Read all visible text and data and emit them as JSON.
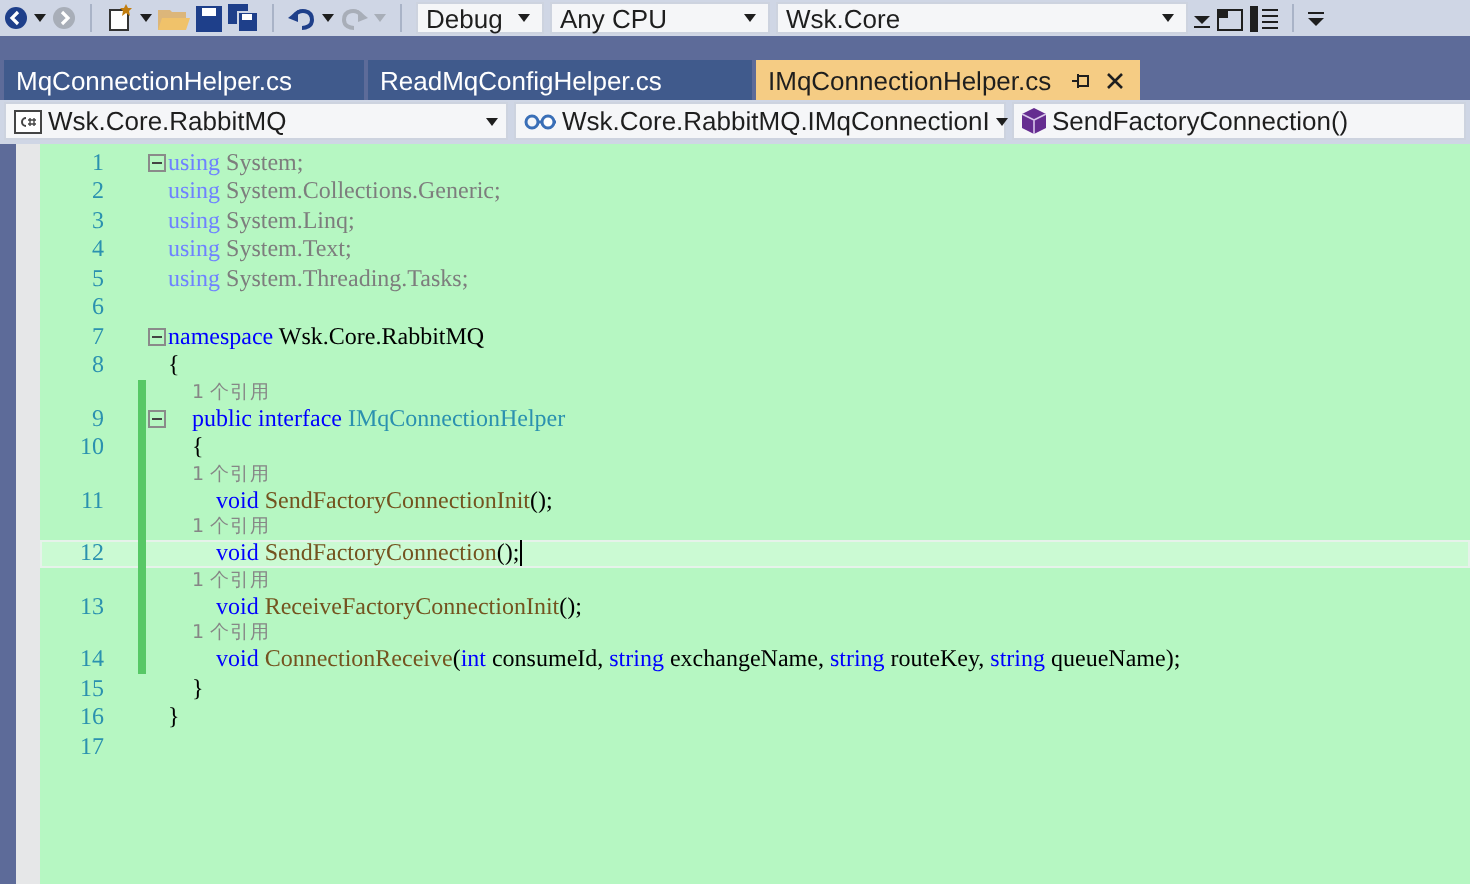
{
  "toolbar": {
    "configuration": "Debug",
    "platform": "Any CPU",
    "startup_project": "Wsk.Core"
  },
  "tabs": [
    {
      "label": "MqConnectionHelper.cs",
      "selected": false
    },
    {
      "label": "ReadMqConfigHelper.cs",
      "selected": false
    },
    {
      "label": "IMqConnectionHelper.cs",
      "selected": true
    }
  ],
  "nav_bar": {
    "project": "Wsk.Core.RabbitMQ",
    "type": "Wsk.Core.RabbitMQ.IMqConnectionI",
    "member": "SendFactoryConnection()"
  },
  "lines": [
    {
      "kind": "code",
      "number": "1",
      "faded": true,
      "expanded": true,
      "tokens": [
        {
          "text": "using",
          "kind": "kw"
        },
        {
          "text": " System;",
          "kind": "plain"
        }
      ]
    },
    {
      "kind": "code",
      "number": "2",
      "faded": true,
      "tokens": [
        {
          "text": "using",
          "kind": "kw"
        },
        {
          "text": " System.Collections.Generic;",
          "kind": "plain"
        }
      ]
    },
    {
      "kind": "code",
      "number": "3",
      "faded": true,
      "tokens": [
        {
          "text": "using",
          "kind": "kw"
        },
        {
          "text": " System.Linq;",
          "kind": "plain"
        }
      ]
    },
    {
      "kind": "code",
      "number": "4",
      "faded": true,
      "tokens": [
        {
          "text": "using",
          "kind": "kw"
        },
        {
          "text": " System.Text;",
          "kind": "plain"
        }
      ]
    },
    {
      "kind": "code",
      "number": "5",
      "faded": true,
      "tokens": [
        {
          "text": "using",
          "kind": "kw"
        },
        {
          "text": " System.Threading.Tasks;",
          "kind": "plain"
        }
      ]
    },
    {
      "kind": "code",
      "number": "6"
    },
    {
      "kind": "code",
      "number": "7",
      "expanded": true,
      "tokens": [
        {
          "text": "namespace",
          "kind": "kw"
        },
        {
          "text": " Wsk.Core.RabbitMQ",
          "kind": "plain"
        }
      ]
    },
    {
      "kind": "code",
      "number": "8",
      "tokens": [
        {
          "text": "{",
          "kind": "plain"
        }
      ]
    },
    {
      "kind": "lens",
      "text": "1 个引用",
      "changed": true
    },
    {
      "kind": "code",
      "number": "9",
      "changed": true,
      "expanded": true,
      "tokens": [
        {
          "text": "    public",
          "kind": "kw"
        },
        {
          "text": " interface",
          "kind": "kw"
        },
        {
          "text": " IMqConnectionHelper",
          "kind": "type"
        }
      ]
    },
    {
      "kind": "code",
      "number": "10",
      "changed": true,
      "tokens": [
        {
          "text": "    {",
          "kind": "plain"
        }
      ]
    },
    {
      "kind": "lens",
      "text": "1 个引用",
      "changed": true
    },
    {
      "kind": "code",
      "number": "11",
      "changed": true,
      "tokens": [
        {
          "text": "        void",
          "kind": "kw"
        },
        {
          "text": " SendFactoryConnectionInit",
          "kind": "method"
        },
        {
          "text": "();",
          "kind": "plain"
        }
      ]
    },
    {
      "kind": "lens",
      "text": "1 个引用",
      "changed": true
    },
    {
      "kind": "code",
      "number": "12",
      "changed": true,
      "current": true,
      "tokens": [
        {
          "text": "        void",
          "kind": "kw"
        },
        {
          "text": " SendFactoryConnection",
          "kind": "method"
        },
        {
          "text": "();",
          "kind": "plain"
        }
      ]
    },
    {
      "kind": "lens",
      "text": "1 个引用",
      "changed": true
    },
    {
      "kind": "code",
      "number": "13",
      "changed": true,
      "tokens": [
        {
          "text": "        void",
          "kind": "kw"
        },
        {
          "text": " ReceiveFactoryConnectionInit",
          "kind": "method"
        },
        {
          "text": "();",
          "kind": "plain"
        }
      ]
    },
    {
      "kind": "lens",
      "text": "1 个引用",
      "changed": true
    },
    {
      "kind": "code",
      "number": "14",
      "changed": true,
      "tokens": [
        {
          "text": "        void",
          "kind": "kw"
        },
        {
          "text": " ConnectionReceive",
          "kind": "method"
        },
        {
          "text": "(",
          "kind": "plain"
        },
        {
          "text": "int",
          "kind": "kw"
        },
        {
          "text": " consumeId, ",
          "kind": "plain"
        },
        {
          "text": "string",
          "kind": "kw"
        },
        {
          "text": " exchangeName, ",
          "kind": "plain"
        },
        {
          "text": "string",
          "kind": "kw"
        },
        {
          "text": " routeKey, ",
          "kind": "plain"
        },
        {
          "text": "string",
          "kind": "kw"
        },
        {
          "text": " queueName);",
          "kind": "plain"
        }
      ]
    },
    {
      "kind": "code",
      "number": "15",
      "tokens": [
        {
          "text": "    }",
          "kind": "plain"
        }
      ]
    },
    {
      "kind": "code",
      "number": "16",
      "tokens": [
        {
          "text": "}",
          "kind": "plain"
        }
      ]
    },
    {
      "kind": "code",
      "number": "17"
    }
  ]
}
